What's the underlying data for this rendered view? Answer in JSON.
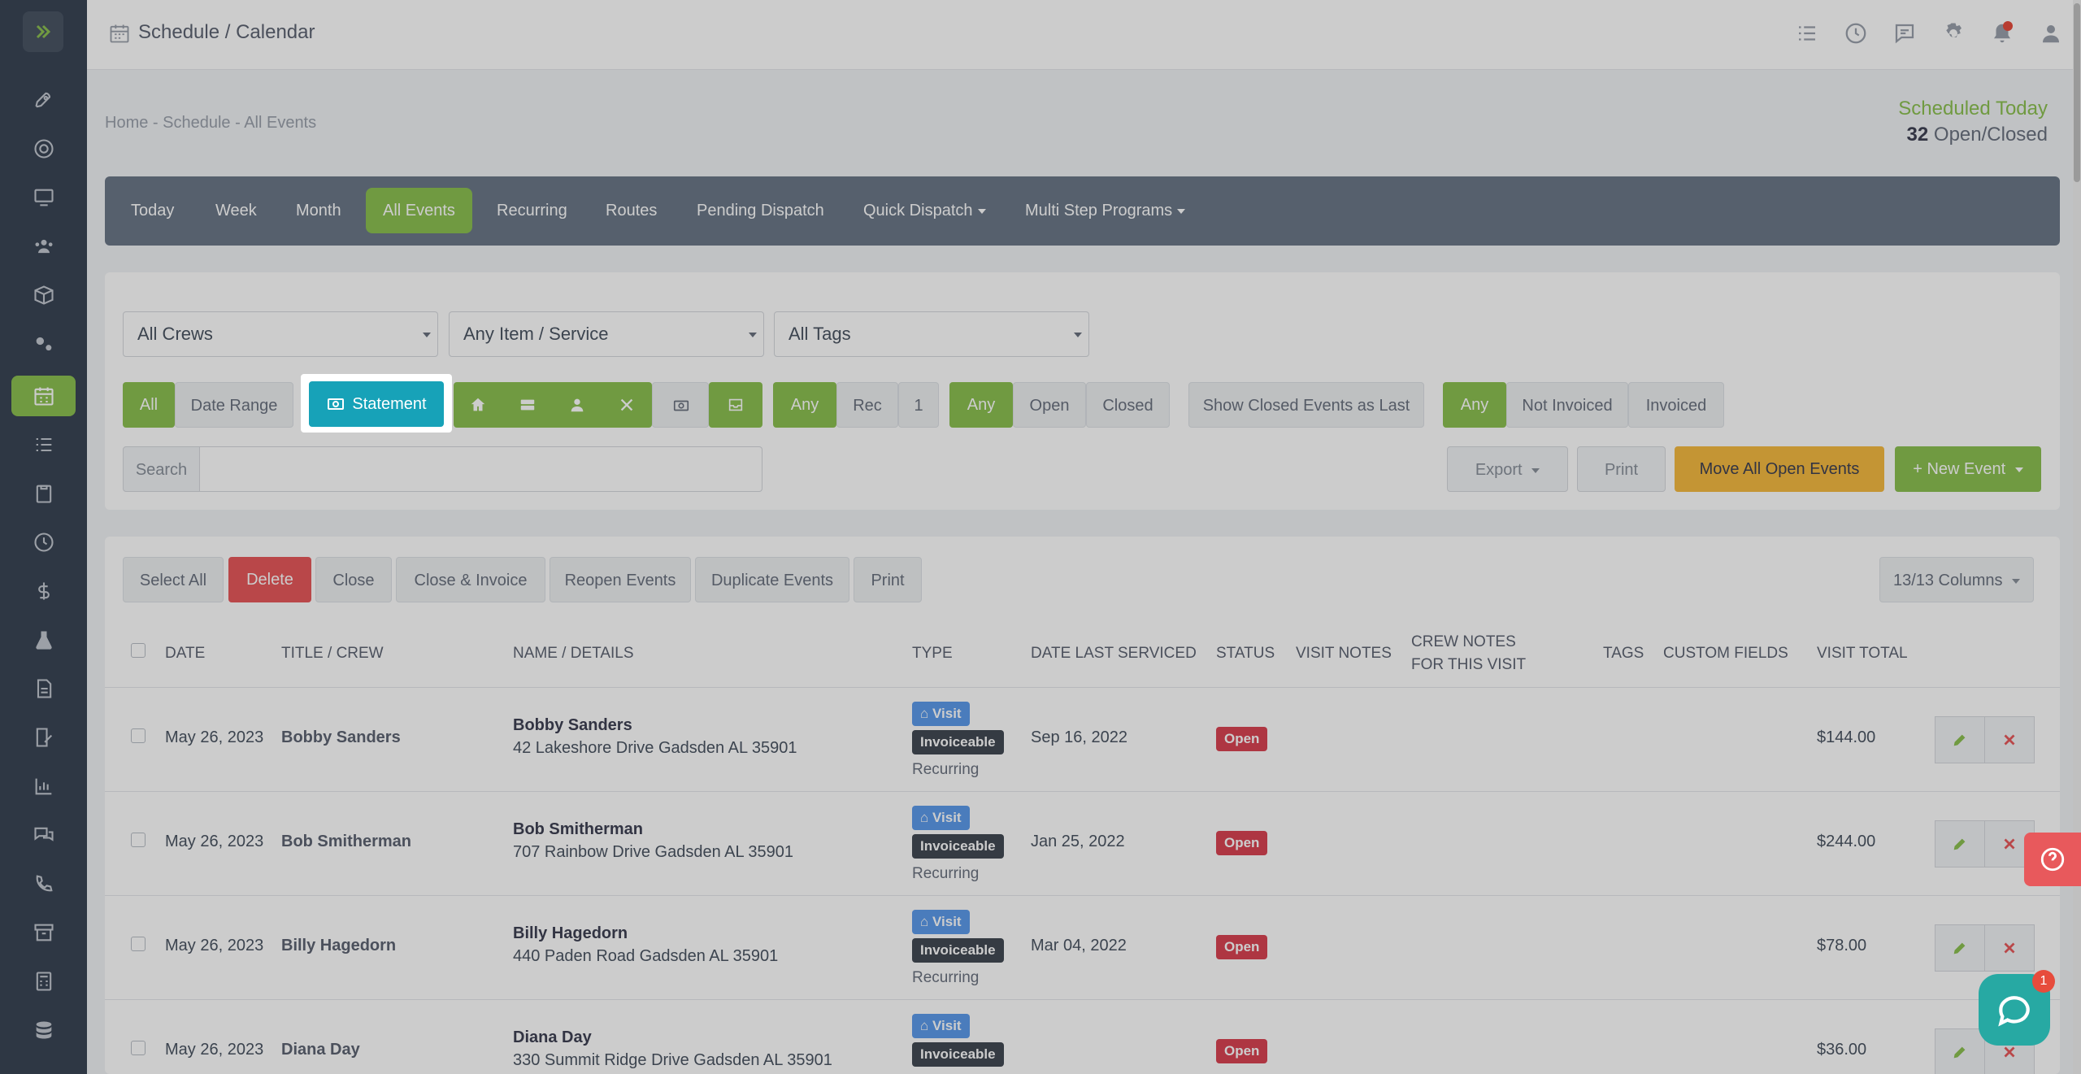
{
  "header": {
    "title": "Schedule / Calendar"
  },
  "breadcrumb": "Home - Schedule - All Events",
  "scheduled": {
    "label": "Scheduled Today",
    "count": "32",
    "suffix": "Open/Closed"
  },
  "nav": {
    "today": "Today",
    "week": "Week",
    "month": "Month",
    "all_events": "All Events",
    "recurring": "Recurring",
    "routes": "Routes",
    "pending_dispatch": "Pending Dispatch",
    "quick_dispatch": "Quick Dispatch",
    "multi_step": "Multi Step Programs"
  },
  "filters": {
    "crews": "All Crews",
    "item_service": "Any Item / Service",
    "tags": "All Tags",
    "all": "All",
    "date_range": "Date Range",
    "statement": "Statement",
    "rec_any": "Any",
    "rec": "Rec",
    "rec_one": "1",
    "status_any": "Any",
    "status_open": "Open",
    "status_closed": "Closed",
    "show_closed_last": "Show Closed Events as Last",
    "inv_any": "Any",
    "not_invoiced": "Not Invoiced",
    "invoiced": "Invoiced",
    "search_label": "Search",
    "search_value": "",
    "export": "Export",
    "print": "Print",
    "move_all": "Move All Open Events",
    "new_event": "+ New Event"
  },
  "bulk": {
    "select_all": "Select All",
    "delete": "Delete",
    "close": "Close",
    "close_invoice": "Close & Invoice",
    "reopen": "Reopen Events",
    "duplicate": "Duplicate Events",
    "print": "Print",
    "columns": "13/13 Columns"
  },
  "table": {
    "headers": {
      "date": "DATE",
      "title": "TITLE / CREW",
      "name": "NAME / DETAILS",
      "type": "TYPE",
      "last_serviced": "DATE LAST SERVICED",
      "status": "STATUS",
      "visit_notes": "VISIT NOTES",
      "crew_notes_1": "CREW NOTES",
      "crew_notes_2": "FOR THIS VISIT",
      "tags": "TAGS",
      "custom_fields": "CUSTOM FIELDS",
      "visit_total": "VISIT TOTAL"
    },
    "rows": [
      {
        "date": "May 26, 2023",
        "crew": "Bobby Sanders",
        "name": "Bobby Sanders",
        "address": "42 Lakeshore Drive Gadsden AL 35901",
        "type": "Visit",
        "invoice": "Invoiceable",
        "recurring": "Recurring",
        "last": "Sep 16, 2022",
        "status": "Open",
        "total": "$144.00"
      },
      {
        "date": "May 26, 2023",
        "crew": "Bob Smitherman",
        "name": "Bob Smitherman",
        "address": "707 Rainbow Drive Gadsden AL 35901",
        "type": "Visit",
        "invoice": "Invoiceable",
        "recurring": "Recurring",
        "last": "Jan 25, 2022",
        "status": "Open",
        "total": "$244.00"
      },
      {
        "date": "May 26, 2023",
        "crew": "Billy Hagedorn",
        "name": "Billy Hagedorn",
        "address": "440 Paden Road Gadsden AL 35901",
        "type": "Visit",
        "invoice": "Invoiceable",
        "recurring": "Recurring",
        "last": "Mar 04, 2022",
        "status": "Open",
        "total": "$78.00"
      },
      {
        "date": "May 26, 2023",
        "crew": "Diana Day",
        "name": "Diana Day",
        "address": "330 Summit Ridge Drive Gadsden AL 35901",
        "type": "Visit",
        "invoice": "Invoiceable",
        "recurring": "",
        "last": "",
        "status": "Open",
        "total": "$36.00"
      }
    ]
  },
  "chat": {
    "badge": "1"
  }
}
